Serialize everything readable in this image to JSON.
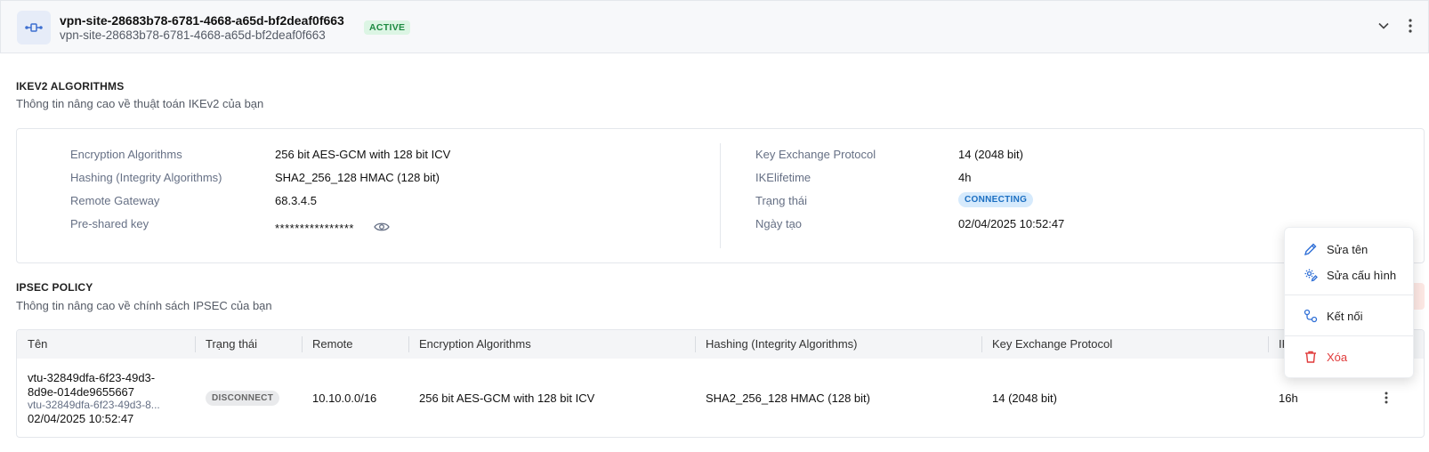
{
  "header": {
    "title": "vpn-site-28683b78-6781-4668-a65d-bf2deaf0f663",
    "subtitle": "vpn-site-28683b78-6781-4668-a65d-bf2deaf0f663",
    "status": "ACTIVE"
  },
  "ikev2": {
    "title": "IKEV2 ALGORITHMS",
    "description": "Thông tin nâng cao về thuật toán IKEv2 của bạn",
    "left": [
      {
        "label": "Encryption Algorithms",
        "value": "256 bit AES-GCM with 128 bit ICV"
      },
      {
        "label": "Hashing (Integrity Algorithms)",
        "value": "SHA2_256_128 HMAC (128 bit)"
      },
      {
        "label": "Remote Gateway",
        "value": "68.3.4.5"
      },
      {
        "label": "Pre-shared key",
        "value": "****************"
      }
    ],
    "right": [
      {
        "label": "Key Exchange Protocol",
        "value": "14 (2048 bit)"
      },
      {
        "label": "IKElifetime",
        "value": "4h"
      },
      {
        "label": "Trạng thái",
        "value": "CONNECTING"
      },
      {
        "label": "Ngày tạo",
        "value": "02/04/2025 10:52:47"
      }
    ]
  },
  "ipsec": {
    "title": "IPSEC POLICY",
    "description": "Thông tin nâng cao về chính sách IPSEC của bạn",
    "columns": [
      "Tên",
      "Trạng thái",
      "Remote",
      "Encryption Algorithms",
      "Hashing (Integrity Algorithms)",
      "Key Exchange Protocol",
      "IK"
    ],
    "rows": [
      {
        "name_line1": "vtu-32849dfa-6f23-49d3-",
        "name_line2": "8d9e-014de9655667",
        "name_sub": "vtu-32849dfa-6f23-49d3-8...",
        "created": "02/04/2025 10:52:47",
        "status": "DISCONNECT",
        "remote": "10.10.0.0/16",
        "encryption": "256 bit AES-GCM with 128 bit ICV",
        "hashing": "SHA2_256_128 HMAC (128 bit)",
        "key_exchange": "14 (2048 bit)",
        "lifetime": "16h"
      }
    ]
  },
  "context_menu": {
    "items": [
      {
        "label": "Sửa tên",
        "icon": "pencil-icon"
      },
      {
        "label": "Sửa cấu hình",
        "icon": "settings-edit-icon"
      },
      {
        "label": "Kết nối",
        "icon": "connect-icon"
      },
      {
        "label": "Xóa",
        "icon": "trash-icon"
      }
    ]
  },
  "colors": {
    "active_bg": "#dcf5e4",
    "active_fg": "#1e8a42",
    "connecting_bg": "#d6eafc",
    "connecting_fg": "#1b6fc2",
    "danger": "#e03a3a",
    "accent": "#2f6fd6"
  }
}
